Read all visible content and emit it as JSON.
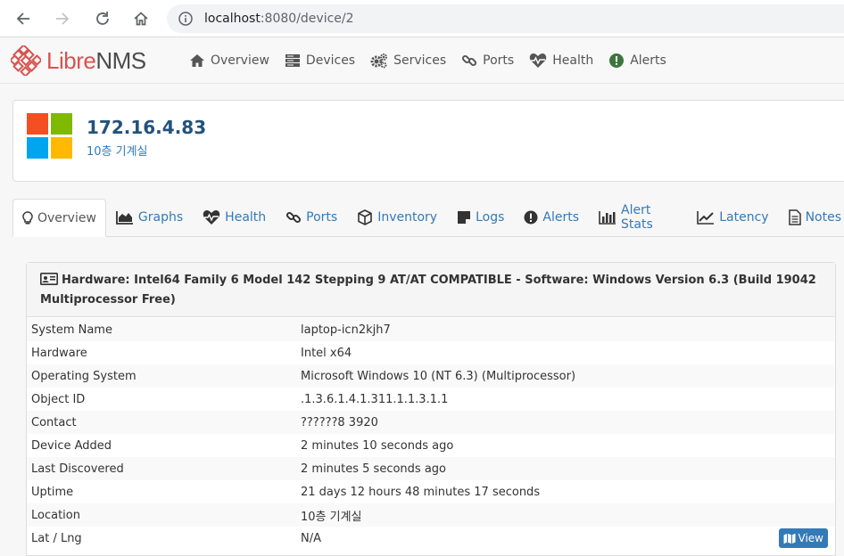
{
  "browser": {
    "url_host": "localhost",
    "url_rest": ":8080/device/2"
  },
  "brand": {
    "libre": "Libre",
    "nms": "NMS",
    "colors": {
      "accent": "#d9534f",
      "link": "#337ab7"
    }
  },
  "menu": [
    {
      "label": "Overview",
      "icon": "home-icon"
    },
    {
      "label": "Devices",
      "icon": "server-icon"
    },
    {
      "label": "Services",
      "icon": "cogs-icon"
    },
    {
      "label": "Ports",
      "icon": "link-icon"
    },
    {
      "label": "Health",
      "icon": "heartbeat-icon"
    },
    {
      "label": "Alerts",
      "icon": "exclamation-circle-icon"
    }
  ],
  "device": {
    "title": "172.16.4.83",
    "location": "10층 기계실",
    "os_logo": "windows-logo"
  },
  "tabs": [
    {
      "label": "Overview",
      "icon": "lightbulb-icon",
      "active": true
    },
    {
      "label": "Graphs",
      "icon": "area-chart-icon"
    },
    {
      "label": "Health",
      "icon": "heartbeat-icon"
    },
    {
      "label": "Ports",
      "icon": "link-icon"
    },
    {
      "label": "Inventory",
      "icon": "cube-icon"
    },
    {
      "label": "Logs",
      "icon": "sticky-note-icon"
    },
    {
      "label": "Alerts",
      "icon": "exclamation-circle-icon"
    },
    {
      "label": "Alert Stats",
      "icon": "bar-chart-icon"
    },
    {
      "label": "Latency",
      "icon": "line-chart-icon"
    },
    {
      "label": "Notes",
      "icon": "file-text-icon"
    }
  ],
  "overview": {
    "heading": "Hardware: Intel64 Family 6 Model 142 Stepping 9 AT/AT COMPATIBLE - Software: Windows Version 6.3 (Build 19042 Multiprocessor Free)",
    "rows": [
      {
        "key": "System Name",
        "value": "laptop-icn2kjh7"
      },
      {
        "key": "Hardware",
        "value": "Intel x64"
      },
      {
        "key": "Operating System",
        "value": "Microsoft Windows 10 (NT 6.3) (Multiprocessor)"
      },
      {
        "key": "Object ID",
        "value": ".1.3.6.1.4.1.311.1.1.3.1.1"
      },
      {
        "key": "Contact",
        "value": "??????8 3920"
      },
      {
        "key": "Device Added",
        "value": "2 minutes 10 seconds ago"
      },
      {
        "key": "Last Discovered",
        "value": "2 minutes 5 seconds ago"
      },
      {
        "key": "Uptime",
        "value": "21 days 12 hours 48 minutes 17 seconds"
      },
      {
        "key": "Location",
        "value": "10층 기계실"
      },
      {
        "key": "Lat / Lng",
        "value": "N/A"
      }
    ],
    "view_label": "View"
  }
}
